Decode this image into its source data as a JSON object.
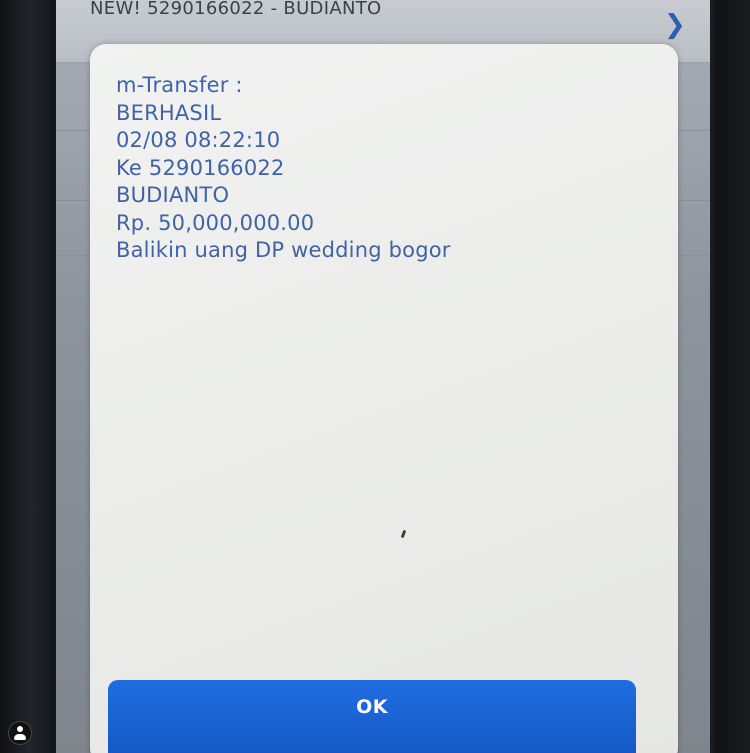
{
  "list_row": {
    "text": "NEW! 5290166022 - BUDIANTO"
  },
  "dialog": {
    "lines": [
      "m-Transfer :",
      "BERHASIL",
      "02/08 08:22:10",
      "Ke 5290166022",
      "BUDIANTO",
      "Rp. 50,000,000.00",
      "Balikin uang DP wedding bogor"
    ],
    "ok_label": "OK"
  },
  "colors": {
    "message_text": "#3f63a6",
    "ok_button": "#1f6de0",
    "chevron": "#2b5fae"
  },
  "icons": {
    "chevron": "chevron-right-icon",
    "avatar": "user-avatar-icon"
  }
}
